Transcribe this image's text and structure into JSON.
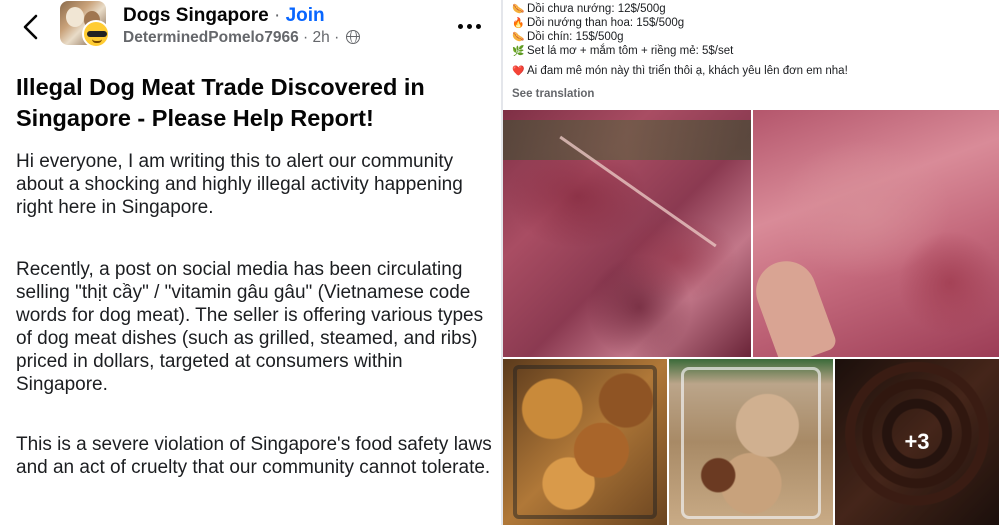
{
  "header": {
    "group_name": "Dogs Singapore",
    "separator": " · ",
    "join_label": "Join",
    "author": "DeterminedPomelo7966",
    "time": " · 2h · "
  },
  "post": {
    "title": "Illegal Dog Meat Trade Discovered in Singapore - Please Help Report!",
    "paragraphs": [
      "Hi everyone, I am writing this to alert our community about a shocking and highly illegal activity happening right here in Singapore.",
      "Recently, a post on social media has been circulating selling \"thịt cầy\" / \"vitamin gâu gâu\" (Vietnamese code words for dog meat). The seller is offering various types of dog meat dishes (such as grilled, steamed, and ribs) priced in dollars, targeted at consumers within Singapore.",
      "This is a severe violation of Singapore's food safety laws and an act of cruelty that our community cannot tolerate."
    ]
  },
  "screenshot_post": {
    "menu": [
      {
        "icon": "sausage-icon",
        "glyph": "🌭",
        "text": "Dồi chưa nướng: 12$/500g"
      },
      {
        "icon": "fire-icon",
        "glyph": "🔥",
        "text": "Dồi nướng than hoa: 15$/500g"
      },
      {
        "icon": "sausage-icon",
        "glyph": "🌭",
        "text": "Dồi chín: 15$/500g"
      },
      {
        "icon": "herb-icon",
        "glyph": "🌿",
        "text": "Set lá mơ + mắm tôm + riềng mẻ: 5$/set"
      }
    ],
    "closing": {
      "icon": "heart-icon",
      "glyph": "❤️",
      "text": "Ai đam mê món này thì triển thôi ạ, khách yêu lên đơn em nha!"
    },
    "see_translation": "See translation",
    "more_photos": "+3"
  }
}
